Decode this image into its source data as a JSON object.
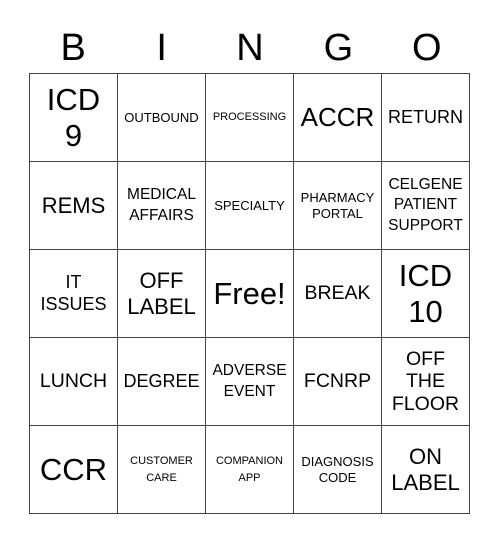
{
  "header": [
    "B",
    "I",
    "N",
    "G",
    "O"
  ],
  "cells": [
    {
      "text": "ICD\n9",
      "size": "s31"
    },
    {
      "text": "OUTBOUND",
      "size": "s13"
    },
    {
      "text": "PROCESSING",
      "size": "s11"
    },
    {
      "text": "ACCR",
      "size": "s26"
    },
    {
      "text": "RETURN",
      "size": "s18"
    },
    {
      "text": "REMS",
      "size": "s22"
    },
    {
      "text": "MEDICAL\nAFFAIRS",
      "size": "s15"
    },
    {
      "text": "SPECIALTY",
      "size": "s13"
    },
    {
      "text": "PHARMACY\nPORTAL",
      "size": "s13"
    },
    {
      "text": "CELGENE\nPATIENT\nSUPPORT",
      "size": "s15"
    },
    {
      "text": "IT\nISSUES",
      "size": "s18"
    },
    {
      "text": "OFF\nLABEL",
      "size": "s22"
    },
    {
      "text": "Free!",
      "size": "s31"
    },
    {
      "text": "BREAK",
      "size": "s20"
    },
    {
      "text": "ICD\n10",
      "size": "s31"
    },
    {
      "text": "LUNCH",
      "size": "s20"
    },
    {
      "text": "DEGREE",
      "size": "s18"
    },
    {
      "text": "ADVERSE\nEVENT",
      "size": "s15"
    },
    {
      "text": "FCNRP",
      "size": "s20"
    },
    {
      "text": "OFF\nTHE\nFLOOR",
      "size": "s20"
    },
    {
      "text": "CCR",
      "size": "s31"
    },
    {
      "text": "CUSTOMER\nCARE",
      "size": "s11"
    },
    {
      "text": "COMPANION\nAPP",
      "size": "s11"
    },
    {
      "text": "DIAGNOSIS\nCODE",
      "size": "s13"
    },
    {
      "text": "ON\nLABEL",
      "size": "s22"
    }
  ]
}
